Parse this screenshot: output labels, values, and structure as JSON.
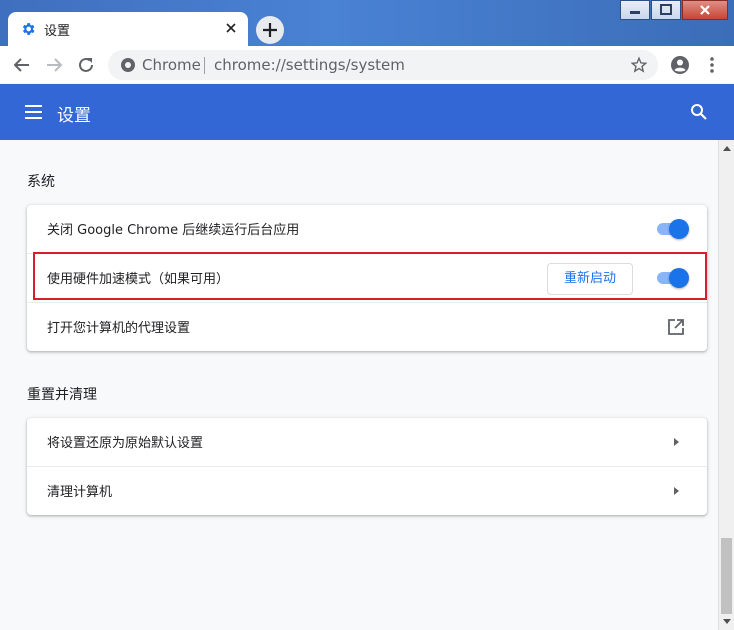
{
  "browser": {
    "tab": {
      "title": "设置",
      "favicon": "gear-icon",
      "close_icon": "close-icon"
    },
    "new_tab_icon": "plus-icon",
    "window_controls": [
      "minimize-icon",
      "maximize-icon",
      "close-icon"
    ],
    "toolbar": {
      "back_icon": "back-arrow-icon",
      "forward_icon": "forward-arrow-icon",
      "reload_icon": "reload-icon",
      "site_label": "Chrome",
      "url": "chrome://settings/system",
      "star_icon": "star-icon",
      "profile_icon": "account-icon",
      "menu_icon": "more-vert-icon"
    }
  },
  "settings_header": {
    "title": "设置",
    "menu_icon": "hamburger-menu-icon",
    "search_icon": "search-icon"
  },
  "sections": [
    {
      "title": "系统",
      "rows": [
        {
          "label": "关闭 Google Chrome 后继续运行后台应用",
          "control": "toggle",
          "on": true
        },
        {
          "label": "使用硬件加速模式（如果可用）",
          "control": "toggle",
          "on": true,
          "button": "重新启动",
          "highlighted": true
        },
        {
          "label": "打开您计算机的代理设置",
          "control": "external-link-icon"
        }
      ]
    },
    {
      "title": "重置并清理",
      "rows": [
        {
          "label": "将设置还原为原始默认设置",
          "control": "arrow-right-icon"
        },
        {
          "label": "清理计算机",
          "control": "arrow-right-icon"
        }
      ]
    }
  ],
  "colors": {
    "header": "#3367d6",
    "toggle_knob": "#1a73e8",
    "toggle_track": "#8ab4f8",
    "highlight_border": "#d61f2b",
    "link": "#1a73e8"
  }
}
